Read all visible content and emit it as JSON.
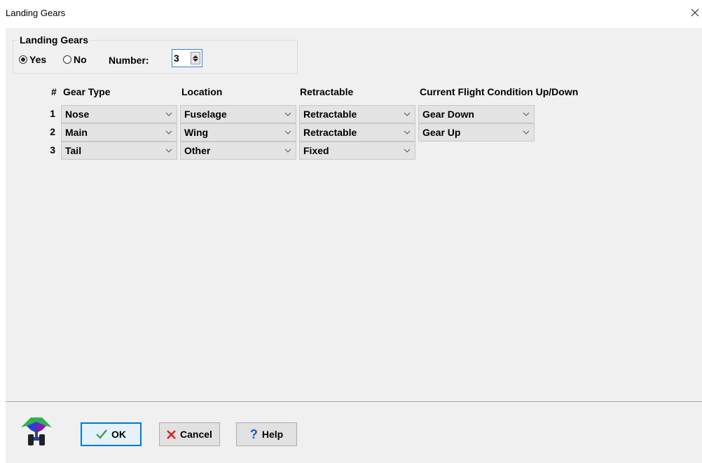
{
  "window": {
    "title": "Landing Gears"
  },
  "group": {
    "legend": "Landing Gears",
    "yes_label": "Yes",
    "no_label": "No",
    "selected": "Yes",
    "number_label": "Number:",
    "number_value": "3"
  },
  "table": {
    "headers": {
      "num": "#",
      "gear_type": "Gear Type",
      "location": "Location",
      "retractable": "Retractable",
      "flight_condition": "Current Flight Condition Up/Down"
    },
    "rows": [
      {
        "num": "1",
        "gear_type": "Nose",
        "location": "Fuselage",
        "retractable": "Retractable",
        "flight_condition": "Gear Down"
      },
      {
        "num": "2",
        "gear_type": "Main",
        "location": "Wing",
        "retractable": "Retractable",
        "flight_condition": "Gear Up"
      },
      {
        "num": "3",
        "gear_type": "Tail",
        "location": "Other",
        "retractable": "Fixed"
      }
    ]
  },
  "buttons": {
    "ok": "OK",
    "cancel": "Cancel",
    "help": "Help"
  },
  "colors": {
    "ok_check": "#3a9a3a",
    "cancel_x": "#d81e1e",
    "help_q": "#1a57c9",
    "focus": "#0078d7"
  },
  "icons": {
    "close": "close-icon",
    "logo": "landing-gear-icon"
  }
}
